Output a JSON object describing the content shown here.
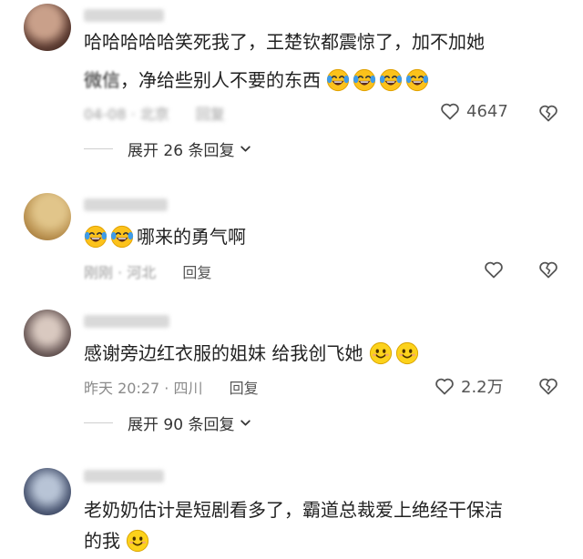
{
  "comments": [
    {
      "text_line1": "哈哈哈哈哈笑死我了，王楚钦都震惊了，加不加她",
      "text_line2_prefix": "微信",
      "text_line2": "，净给些别人不要的东西",
      "meta_blurred": "04-08 · 北京",
      "reply_label": "回复",
      "likes": "4647",
      "expand_label": "展开 26 条回复"
    },
    {
      "text": "哪来的勇气啊",
      "meta_time": "刚刚 · 河北",
      "reply_label": "回复",
      "likes": ""
    },
    {
      "text": "感谢旁边红衣服的姐妹  给我创飞她",
      "meta_time": "昨天 20:27 · 四川",
      "reply_label": "回复",
      "likes": "2.2万",
      "expand_label": "展开 90 条回复"
    },
    {
      "text_line1": "老奶奶估计是短剧看多了，霸道总裁爱上绝经干保洁",
      "text_line2": "的我"
    }
  ],
  "icons": {
    "like": "heart-outline-icon",
    "dislike": "broken-heart-icon",
    "expand": "chevron-down-icon",
    "emoji_laugh": "crying-laughing-emoji",
    "emoji_smile": "smiling-emoji"
  },
  "colors": {
    "text": "#222222",
    "meta": "#8a8a8a",
    "emoji_face": "#fcc21b",
    "tear": "#3e9be9"
  }
}
